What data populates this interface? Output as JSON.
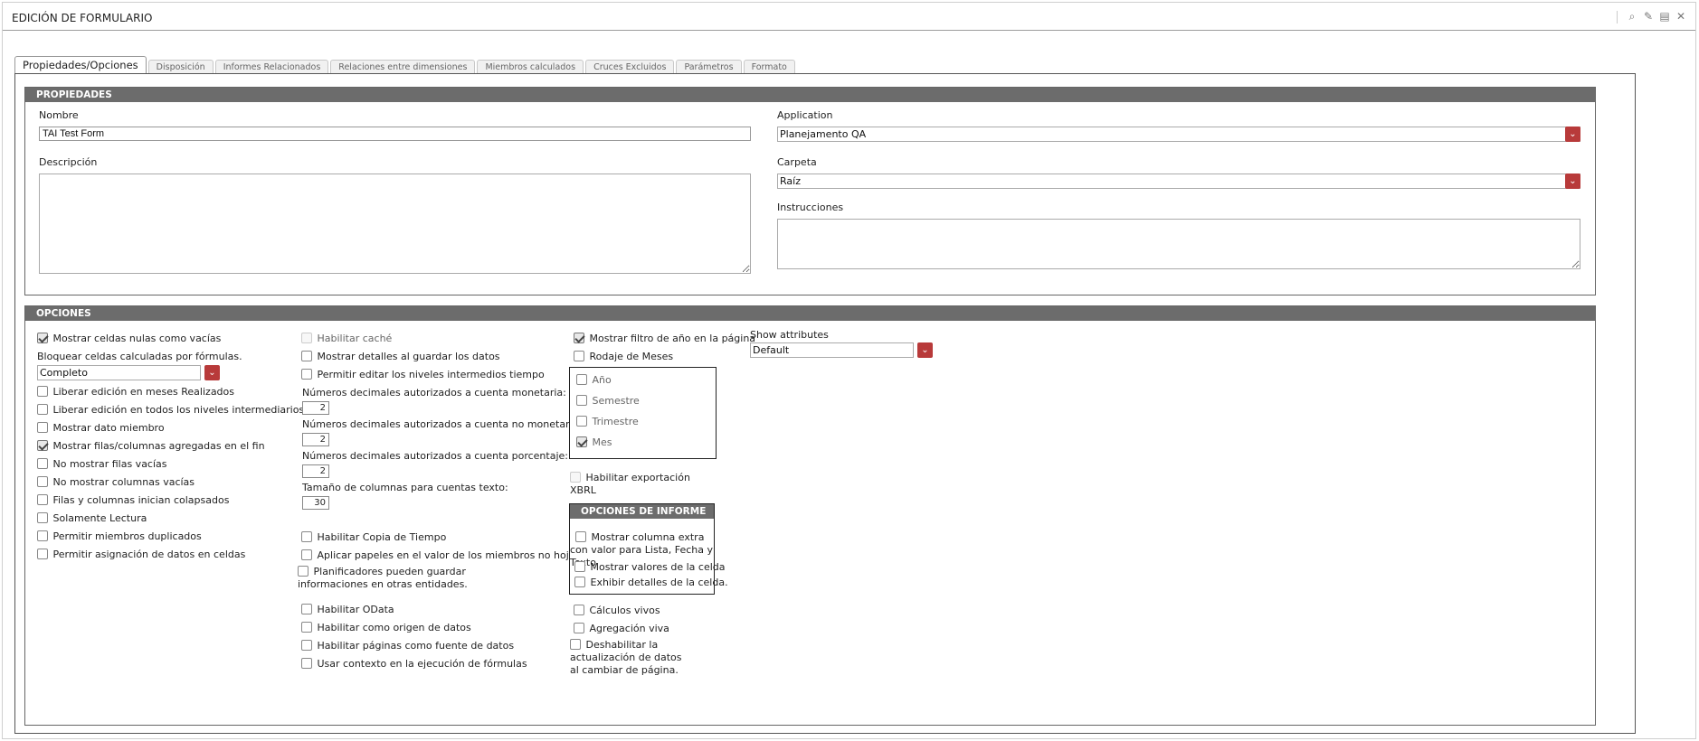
{
  "window": {
    "title": "EDICIÓN DE FORMULARIO"
  },
  "tabs": [
    {
      "label": "Propiedades/Opciones",
      "active": true
    },
    {
      "label": "Disposición"
    },
    {
      "label": "Informes Relacionados"
    },
    {
      "label": "Relaciones entre dimensiones"
    },
    {
      "label": "Miembros calculados"
    },
    {
      "label": "Cruces Excluidos"
    },
    {
      "label": "Parámetros"
    },
    {
      "label": "Formato"
    }
  ],
  "properties": {
    "header": "PROPIEDADES",
    "name_label": "Nombre",
    "name_value": "TAI Test Form",
    "description_label": "Descripción",
    "application_label": "Application",
    "application_value": "Planejamento QA",
    "folder_label": "Carpeta",
    "folder_value": "Raíz",
    "instructions_label": "Instrucciones"
  },
  "options": {
    "header": "OPCIONES",
    "col1": {
      "show_null": {
        "label": "Mostrar celdas nulas como vacías",
        "checked": true
      },
      "block_label": "Bloquear celdas calculadas por fórmulas.",
      "block_value": "Completo",
      "release_realized": {
        "label": "Liberar edición en meses Realizados",
        "checked": false
      },
      "release_all": {
        "label": "Liberar edición en todos los niveles intermediarios",
        "checked": false
      },
      "show_member": {
        "label": "Mostrar dato miembro",
        "checked": false
      },
      "show_aggregated": {
        "label": "Mostrar filas/columnas agregadas en el fin",
        "checked": true
      },
      "no_empty_rows": {
        "label": "No mostrar filas vacías",
        "checked": false
      },
      "no_empty_cols": {
        "label": "No mostrar columnas vacías",
        "checked": false
      },
      "collapsed": {
        "label": "Filas y columnas inician colapsados",
        "checked": false
      },
      "read_only": {
        "label": "Solamente Lectura",
        "checked": false
      },
      "duplicates": {
        "label": "Permitir miembros duplicados",
        "checked": false
      },
      "data_assign": {
        "label": "Permitir asignación de datos en celdas",
        "checked": false
      }
    },
    "col2": {
      "cache": {
        "label": "Habilitar caché",
        "checked": false
      },
      "show_details": {
        "label": "Mostrar detalles al guardar los datos",
        "checked": false
      },
      "edit_time": {
        "label": "Permitir editar los niveles intermedios tiempo",
        "checked": false
      },
      "dec_monetary_label": "Números decimales autorizados a cuenta monetaria:",
      "dec_monetary_value": "2",
      "dec_nonmonetary_label": "Números decimales autorizados a cuenta no monetaria:",
      "dec_nonmonetary_value": "2",
      "dec_percent_label": "Números decimales autorizados a cuenta porcentaje:",
      "dec_percent_value": "2",
      "col_size_label": "Tamaño de columnas para cuentas texto:",
      "col_size_value": "30",
      "time_copy": {
        "label": "Habilitar Copia de Tiempo",
        "checked": false
      },
      "apply_roles": {
        "label": "Aplicar papeles en el valor de los miembros no hoja",
        "checked": false
      },
      "planners": {
        "label": "Planificadores pueden guardar informaciones en otras entidades.",
        "checked": false
      },
      "odata": {
        "label": "Habilitar OData",
        "checked": false
      },
      "datasource": {
        "label": "Habilitar como origen de datos",
        "checked": false
      },
      "pages_source": {
        "label": "Habilitar páginas como fuente de datos",
        "checked": false
      },
      "context": {
        "label": "Usar contexto en la ejecución de fórmulas",
        "checked": false
      }
    },
    "col3": {
      "year_filter": {
        "label": "Mostrar filtro de año en la página",
        "checked": true
      },
      "rolling": {
        "label": "Rodaje de Meses",
        "checked": false
      },
      "periods": [
        {
          "label": "Año",
          "checked": false
        },
        {
          "label": "Semestre",
          "checked": false
        },
        {
          "label": "Trimestre",
          "checked": false
        },
        {
          "label": "Mes",
          "checked": true
        }
      ],
      "xbrl": {
        "label": "Habilitar exportación XBRL",
        "checked": false
      },
      "report_options_header": "OPCIONES DE INFORME",
      "extra_column": {
        "label": "Mostrar columna extra con valor para Lista, Fecha y Texto",
        "checked": false
      },
      "show_values": {
        "label": "Mostrar valores de la celda",
        "checked": false
      },
      "cell_details": {
        "label": "Exhibir detalles de la celda.",
        "checked": false
      },
      "live_calc": {
        "label": "Cálculos vivos",
        "checked": false
      },
      "live_agg": {
        "label": "Agregación viva",
        "checked": false
      },
      "disable_update": {
        "label": "Deshabilitar la actualización de datos al cambiar de página.",
        "checked": false
      }
    },
    "col4": {
      "show_attributes_label": "Show attributes",
      "show_attributes_value": "Default"
    }
  }
}
